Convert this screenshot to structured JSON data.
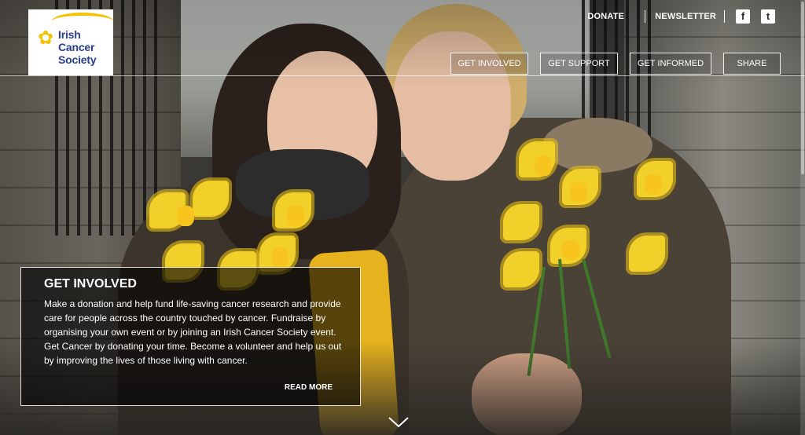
{
  "logo": {
    "line1": "Irish",
    "line2": "Cancer",
    "line3": "Society"
  },
  "top_links": {
    "donate": "DONATE",
    "newsletter": "NEWSLETTER"
  },
  "social": {
    "facebook": "f",
    "twitter": "t"
  },
  "nav": [
    "GET INVOLVED",
    "GET SUPPORT",
    "GET INFORMED",
    "SHARE"
  ],
  "panel": {
    "title": "GET INVOLVED",
    "body": "Make a donation and help fund life-saving cancer research and provide care for people across the country touched by cancer. Fundraise by organising your own event or by joining an Irish Cancer Society event. Get Cancer by donating your time. Become a volunteer and help us out by improving the lives of those living with cancer.",
    "read_more": "READ MORE"
  },
  "colors": {
    "brand_blue": "#283f8e",
    "brand_yellow": "#f2c300"
  },
  "icons": {
    "scroll": "chevron-down-icon"
  }
}
